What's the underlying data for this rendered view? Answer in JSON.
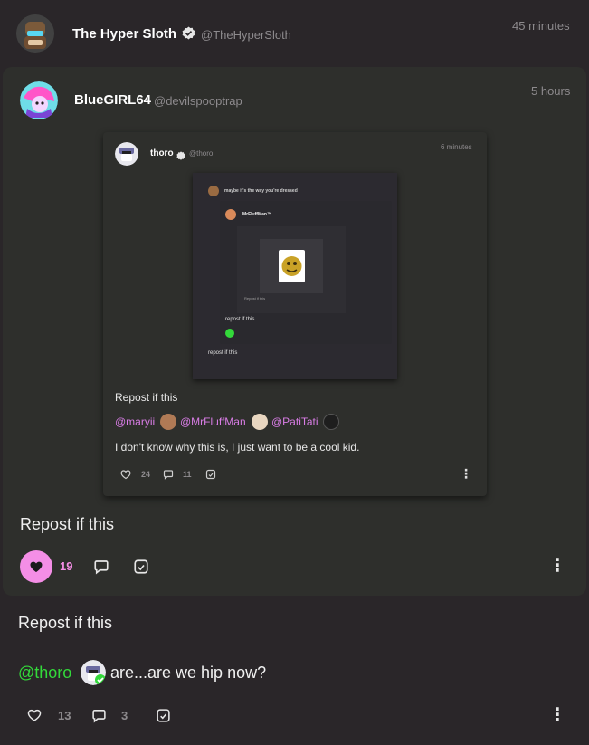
{
  "outer": {
    "name": "The Hyper Sloth",
    "handle": "@TheHyperSloth",
    "time": "45 minutes",
    "text": "Repost if this",
    "mention": "@thoro",
    "reply_text": "are...are we hip now?",
    "likes": "13",
    "comments": "3"
  },
  "quote1": {
    "name": "BlueGIRL64",
    "handle": "@devilspooptrap",
    "time": "5 hours",
    "text": "Repost if this",
    "likes": "19"
  },
  "quote2": {
    "name": "thoro",
    "handle": "@thoro",
    "time": "6 minutes",
    "text": "Repost if this",
    "mentions": [
      "@maryii",
      "@MrFluffMan",
      "@PatiTati"
    ],
    "body": "I don't know why this is, I just want to be a cool kid.",
    "likes": "24",
    "comments": "11"
  },
  "quote3": {
    "title": "maybe it's the way you're dressed",
    "text": "repost if this"
  },
  "quote4": {
    "name": "MrFluffMan™",
    "text": "repost if this"
  },
  "quote5": {
    "text": "Repost if this"
  },
  "colors": {
    "background": "#2a2629",
    "card": "#2e2f2c",
    "like_active": "#f48ee6",
    "mention": "#d97de6",
    "mention_green": "#33d93a"
  },
  "icons": [
    "verified-icon",
    "heart-icon",
    "comment-icon",
    "repost-icon",
    "more-icon"
  ]
}
